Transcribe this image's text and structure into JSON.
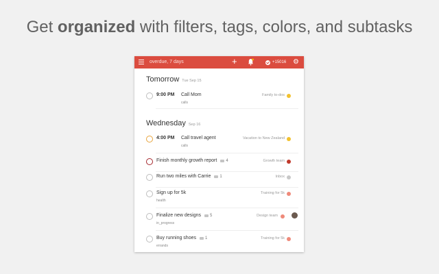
{
  "headline": {
    "prefix": "Get ",
    "bold": "organized",
    "suffix": " with filters, tags, colors, and subtasks"
  },
  "topbar": {
    "filter_label": "overdue, 7 days",
    "add_icon": "plus-icon",
    "bell_icon": "bell-icon",
    "karma_value": "+15016",
    "settings_icon": "gear-icon",
    "color": "#db4c3f"
  },
  "sections": [
    {
      "title": "Tomorrow",
      "date": "Tue Sep 15",
      "tasks": [
        {
          "time": "9:00 PM",
          "name": "Call Mom",
          "label": "calls",
          "project": "Family to-dos",
          "project_color": "#f2c12e"
        }
      ]
    },
    {
      "title": "Wednesday",
      "date": "Sep 16",
      "tasks": [
        {
          "time": "4:00 PM",
          "name": "Call travel agent",
          "label": "calls",
          "project": "Vacation to New Zealand",
          "project_color": "#f2c12e",
          "priority_color": "#e8a33b"
        },
        {
          "name": "Finish monthly growth report",
          "comments": "4",
          "project": "Growth team",
          "project_color": "#c0392b",
          "priority_color": "#a4262c"
        },
        {
          "name": "Run two miles with Carrie",
          "comments": "1",
          "project": "Inbox",
          "project_color": "#c8c8c8"
        },
        {
          "name": "Sign up for 5k",
          "label": "health",
          "project": "Training for 5k",
          "project_color": "#ef8a7a"
        },
        {
          "name": "Finalize new designs",
          "comments": "5",
          "label": "in_progress",
          "project": "Design team",
          "project_color": "#ef8a7a"
        },
        {
          "name": "Buy running shoes",
          "comments": "1",
          "label": "errands",
          "project": "Training for 5k",
          "project_color": "#ef8a7a"
        }
      ]
    }
  ]
}
